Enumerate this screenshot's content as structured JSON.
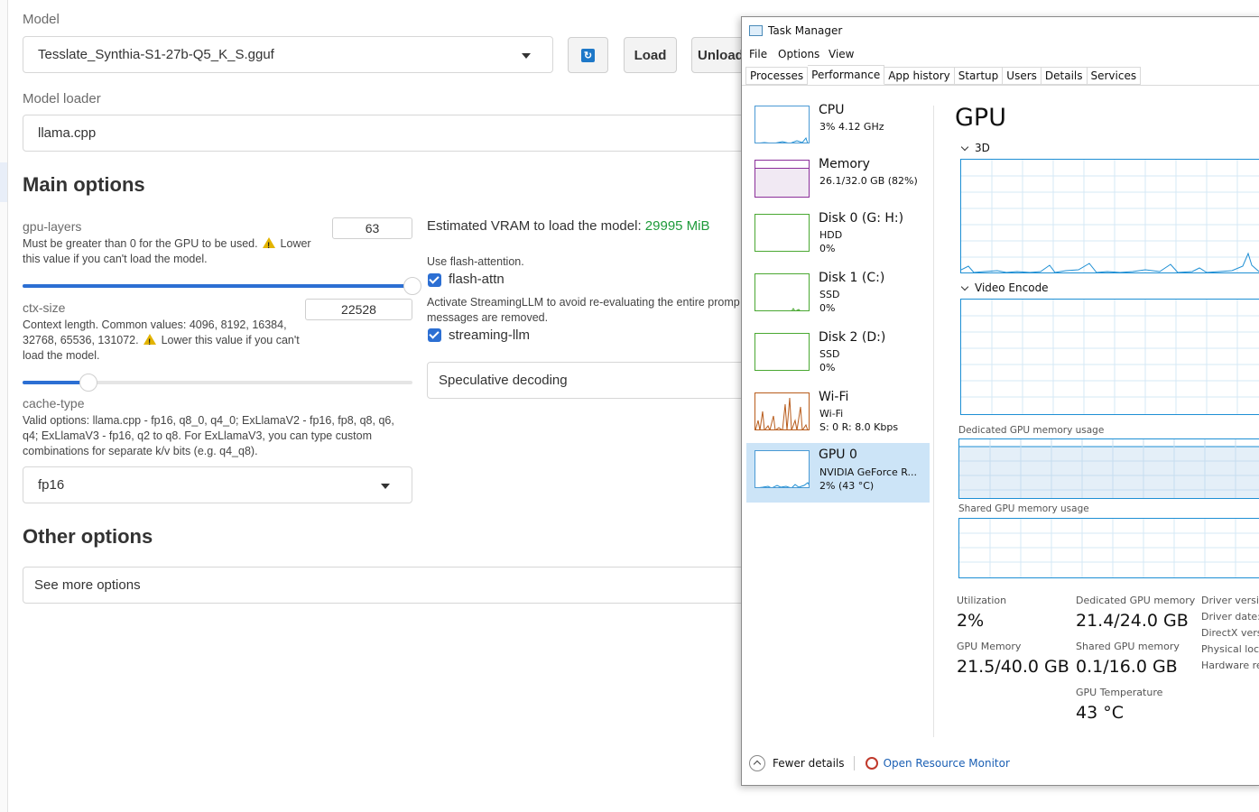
{
  "webui": {
    "model_label": "Model",
    "model_value": "Tesslate_Synthia-S1-27b-Q5_K_S.gguf",
    "refresh_icon": "refresh-icon",
    "load_label": "Load",
    "unload_label": "Unload",
    "loader_label": "Model loader",
    "loader_value": "llama.cpp",
    "main_options": "Main options",
    "gpu_layers": {
      "label": "gpu-layers",
      "value": "63",
      "help_before": "Must be greater than 0 for the GPU to be used.",
      "help_after": "Lower this value if you can't load the model.",
      "slider_fraction": 1.0
    },
    "ctx_size": {
      "label": "ctx-size",
      "value": "22528",
      "help_before": "Context length. Common values: 4096, 8192, 16384, 32768, 65536, 131072.",
      "help_after": "Lower this value if you can't load the model.",
      "slider_fraction": 0.17
    },
    "cache_type": {
      "label": "cache-type",
      "help": "Valid options: llama.cpp - fp16, q8_0, q4_0; ExLlamaV2 - fp16, fp8, q8, q6, q4; ExLlamaV3 - fp16, q2 to q8. For ExLlamaV3, you can type custom combinations for separate k/v bits (e.g. q4_q8).",
      "value": "fp16"
    },
    "vram_label": "Estimated VRAM to load the model:",
    "vram_value": "29995 MiB",
    "vram_color": "#1e9a3a",
    "flash_help": "Use flash-attention.",
    "flash_label": "flash-attn",
    "streaming_help": "Activate StreamingLLM to avoid re-evaluating the entire promp",
    "streaming_help2": "messages are removed.",
    "streaming_label": "streaming-llm",
    "speculative": "Speculative decoding",
    "other_options": "Other options",
    "see_more": "See more options",
    "accent": "#2c6fd3"
  },
  "taskmgr": {
    "title": "Task Manager",
    "menu": [
      "File",
      "Options",
      "View"
    ],
    "tabs": [
      "Processes",
      "Performance",
      "App history",
      "Startup",
      "Users",
      "Details",
      "Services"
    ],
    "active_tab": "Performance",
    "resources": [
      {
        "name": "CPU",
        "sub1": "3% 4.12 GHz",
        "sub2": "",
        "sub3": ""
      },
      {
        "name": "Memory",
        "sub1": "26.1/32.0 GB (82%)",
        "sub2": "",
        "sub3": ""
      },
      {
        "name": "Disk 0 (G: H:)",
        "sub1": "HDD",
        "sub2": "0%",
        "sub3": ""
      },
      {
        "name": "Disk 1 (C:)",
        "sub1": "SSD",
        "sub2": "0%",
        "sub3": ""
      },
      {
        "name": "Disk 2 (D:)",
        "sub1": "SSD",
        "sub2": "0%",
        "sub3": ""
      },
      {
        "name": "Wi-Fi",
        "sub1": "Wi-Fi",
        "sub2": "S: 0 R: 8.0 Kbps",
        "sub3": ""
      },
      {
        "name": "GPU 0",
        "sub1": "NVIDIA GeForce R...",
        "sub2": "2% (43 °C)",
        "sub3": ""
      }
    ],
    "gpu_heading": "GPU",
    "engine_3d": "3D",
    "engine_video": "Video Encode",
    "dedicated_label": "Dedicated GPU memory usage",
    "shared_label": "Shared GPU memory usage",
    "stats": {
      "util_label": "Utilization",
      "util_value": "2%",
      "gpu_mem_label": "GPU Memory",
      "gpu_mem_value": "21.5/40.0 GB",
      "ded_label": "Dedicated GPU memory",
      "ded_value": "21.4/24.0 GB",
      "shared_label": "Shared GPU memory",
      "shared_value": "0.1/16.0 GB",
      "temp_label": "GPU Temperature",
      "temp_value": "43 °C"
    },
    "driver_labels": [
      "Driver versio",
      "Driver date:",
      "DirectX versi",
      "Physical loca",
      "Hardware re"
    ],
    "fewer_details": "Fewer details",
    "open_resmon": "Open Resource Monitor"
  }
}
